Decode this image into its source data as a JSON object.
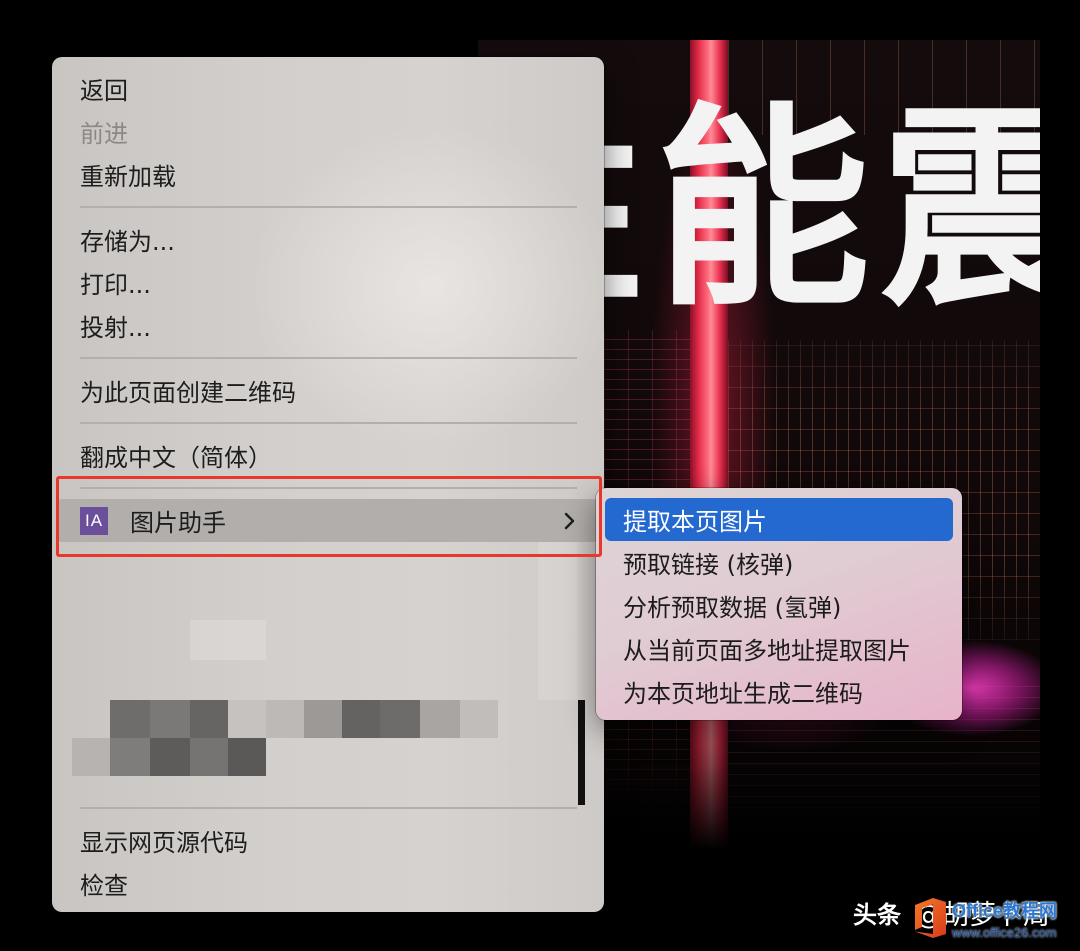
{
  "hero": {
    "headline": "性能震"
  },
  "context_menu": {
    "items": [
      {
        "label": "返回"
      },
      {
        "label": "前进",
        "disabled": true
      },
      {
        "label": "重新加载"
      },
      {
        "label": "存储为..."
      },
      {
        "label": "打印..."
      },
      {
        "label": "投射..."
      },
      {
        "label": "为此页面创建二维码"
      },
      {
        "label": "翻成中文（简体）"
      },
      {
        "label": "图片助手",
        "icon": "image-assistant-icon",
        "icon_text": "IA",
        "has_submenu": true,
        "highlighted": true
      },
      {
        "label": "显示网页源代码"
      },
      {
        "label": "检查"
      }
    ]
  },
  "submenu": {
    "items": [
      {
        "label": "提取本页图片",
        "highlighted": true
      },
      {
        "label": "预取链接 (核弹)"
      },
      {
        "label": "分析预取数据 (氢弹)"
      },
      {
        "label": "从当前页面多地址提取图片"
      },
      {
        "label": "为本页地址生成二维码"
      }
    ]
  },
  "watermark": {
    "platform": "头条",
    "author": "@胡萝卜周"
  },
  "site_logo": {
    "icon": "office-logo-icon",
    "name": "Office教程网",
    "url": "www.office26.com"
  },
  "colors": {
    "selection_blue": "#2469d0",
    "annotation_red": "#e8382c",
    "extension_purple": "#6b4f9b"
  }
}
